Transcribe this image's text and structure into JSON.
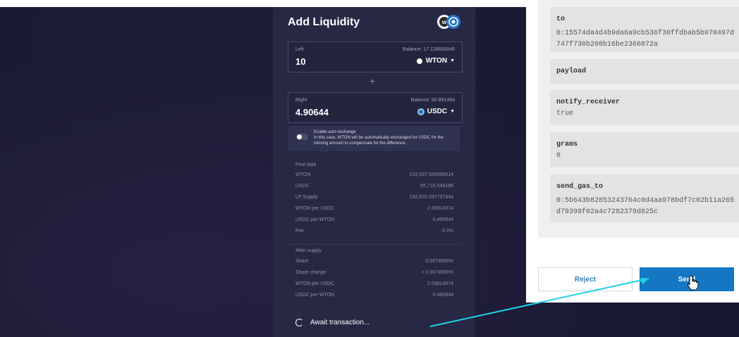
{
  "panel": {
    "title": "Add Liquidity",
    "left": {
      "label": "Left",
      "balance": "Balance: 17.128600046",
      "value": "10",
      "token": "WTON"
    },
    "right": {
      "label": "Right",
      "balance": "Balance: 50.891484",
      "value": "4.90644",
      "token": "USDC"
    },
    "plus_symbol": "+",
    "auto_exchange": {
      "label": "Enable auto exchange",
      "description": "In this case, WTON will be automatically exchanged for USDC for the missing amount to compensate for the difference."
    },
    "pool_data": {
      "title": "Pool data",
      "rows": [
        {
          "label": "WTON",
          "value": "133,937.535999014"
        },
        {
          "label": "USDC",
          "value": "65,715.548186"
        },
        {
          "label": "LP Supply",
          "value": "132,670.297737444"
        },
        {
          "label": "WTON per USDC",
          "value": "2.03814074"
        },
        {
          "label": "USDC per WTON",
          "value": "0.490644"
        },
        {
          "label": "Fee",
          "value": "0.3%"
        }
      ]
    },
    "after_supply": {
      "title": "After supply",
      "rows": [
        {
          "label": "Share",
          "value": "0.0074656%"
        },
        {
          "label": "Share change",
          "value": "+ 0.0074656%"
        },
        {
          "label": "WTON per USDC",
          "value": "2.03814074"
        },
        {
          "label": "USDC per WTON",
          "value": "0.490644"
        }
      ]
    },
    "await_text": "Await transaction..."
  },
  "dialog": {
    "fields": [
      {
        "name": "to",
        "value": "0:15574da4d4b9da6a9cb536f30ffdbab5b070497d747f730b208b16be2366872a"
      },
      {
        "name": "payload",
        "value": ""
      },
      {
        "name": "notify_receiver",
        "value": "true"
      },
      {
        "name": "grams",
        "value": "0"
      },
      {
        "name": "send_gas_to",
        "value": "0:5b643b82853243764c0d4aa978bdf7c02b11a265d79399f02a4c7282379d825c"
      }
    ],
    "reject_label": "Reject",
    "send_label": "Send"
  },
  "colors": {
    "panel_bg": "#262844",
    "send_button": "#1577c4",
    "arrow": "#22d3e6",
    "wton_icon": "#2a2a2a",
    "usdc_icon": "#2775ca"
  },
  "icons": {
    "logo": "wton-logo-icon",
    "wton": "wton-token-icon",
    "usdc": "usdc-token-icon",
    "dropdown": "chevron-down-icon",
    "spinner": "loading-spinner-icon",
    "cursor": "hand-pointer-icon"
  }
}
